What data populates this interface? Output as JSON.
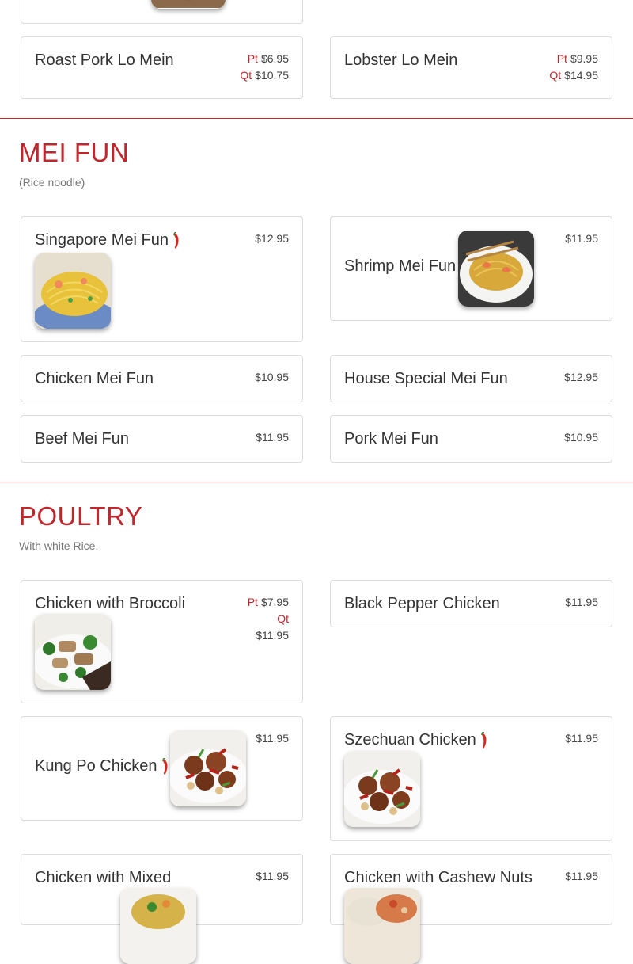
{
  "lo_mein": {
    "roast_pork": {
      "name": "Roast Pork Lo Mein",
      "pt_label": "Pt",
      "pt_price": "$6.95",
      "qt_label": "Qt",
      "qt_price": "$10.75"
    },
    "lobster": {
      "name": "Lobster Lo Mein",
      "pt_label": "Pt",
      "pt_price": "$9.95",
      "qt_label": "Qt",
      "qt_price": "$14.95"
    }
  },
  "mei_fun": {
    "title": "MEI FUN",
    "subtitle": "(Rice noodle)",
    "items": [
      {
        "name": "Singapore Mei Fun",
        "price": "$12.95"
      },
      {
        "name": "Shrimp Mei Fun",
        "price": "$11.95"
      },
      {
        "name": "Chicken Mei Fun",
        "price": "$10.95"
      },
      {
        "name": "House Special Mei Fun",
        "price": "$12.95"
      },
      {
        "name": "Beef Mei Fun",
        "price": "$11.95"
      },
      {
        "name": "Pork Mei Fun",
        "price": "$10.95"
      }
    ]
  },
  "poultry": {
    "title": "POULTRY",
    "subtitle": "With white Rice.",
    "broccoli": {
      "name": "Chicken with Broccoli",
      "pt_label": "Pt",
      "pt_price": "$7.95",
      "qt_label": "Qt",
      "qt_price": "$11.95"
    },
    "items": [
      {
        "name": "Black Pepper Chicken",
        "price": "$11.95"
      },
      {
        "name": "Kung Po Chicken",
        "price": "$11.95"
      },
      {
        "name": "Szechuan Chicken",
        "price": "$11.95"
      },
      {
        "name": "Chicken with Mixed",
        "price": "$11.95"
      },
      {
        "name": "Chicken with Cashew Nuts",
        "price": "$11.95"
      }
    ]
  },
  "colors": {
    "accent": "#c0272d",
    "border": "#dcdcdc"
  },
  "icons": {
    "spicy": "chili-pepper-icon"
  }
}
